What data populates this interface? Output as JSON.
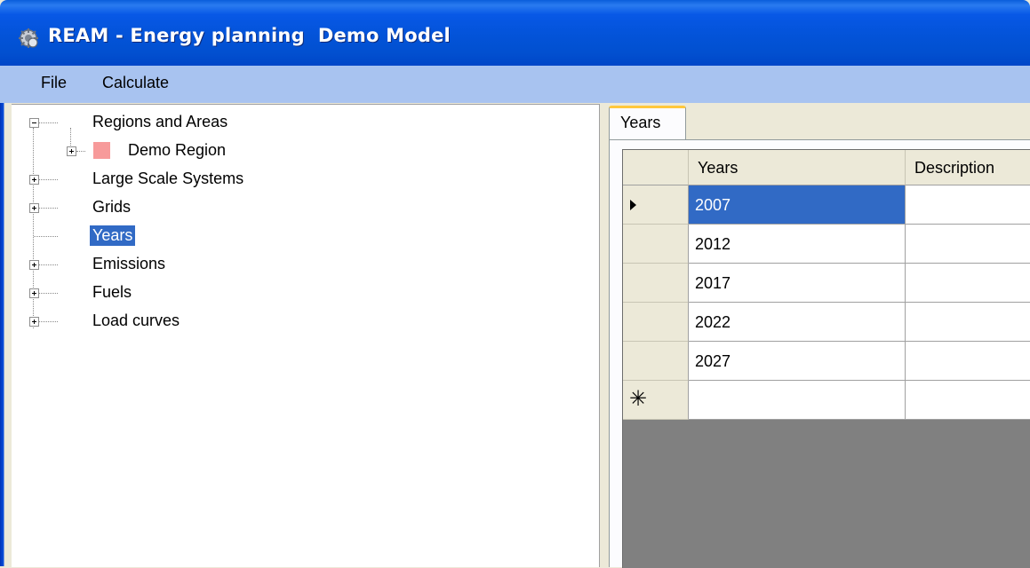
{
  "window": {
    "title": "REAM - Energy planning  Demo Model",
    "icon": "app-gear-icon"
  },
  "menu": {
    "items": [
      {
        "label": "File"
      },
      {
        "label": "Calculate"
      }
    ]
  },
  "tree": {
    "nodes": [
      {
        "label": "Regions and Areas",
        "expander": "minus"
      },
      {
        "label": "Demo Region",
        "expander": "plus",
        "swatch_color": "#f79a9a"
      },
      {
        "label": "Large Scale Systems",
        "expander": "plus"
      },
      {
        "label": "Grids",
        "expander": "plus"
      },
      {
        "label": "Years",
        "expander": "none",
        "selected": true
      },
      {
        "label": "Emissions",
        "expander": "plus"
      },
      {
        "label": "Fuels",
        "expander": "plus"
      },
      {
        "label": "Load curves",
        "expander": "plus"
      }
    ]
  },
  "tabs": [
    {
      "label": "Years",
      "active": true
    }
  ],
  "grid": {
    "columns": [
      "Years",
      "Description"
    ],
    "rows": [
      {
        "years": "2007",
        "description": "",
        "current": true
      },
      {
        "years": "2012",
        "description": ""
      },
      {
        "years": "2017",
        "description": ""
      },
      {
        "years": "2022",
        "description": ""
      },
      {
        "years": "2027",
        "description": ""
      }
    ],
    "new_row_marker": "✳"
  },
  "colors": {
    "titlebar": "#0353d8",
    "menubar": "#a8c3f0",
    "selection": "#316ac5",
    "tab_highlight": "#ffc83c",
    "grid_background": "#808080"
  }
}
